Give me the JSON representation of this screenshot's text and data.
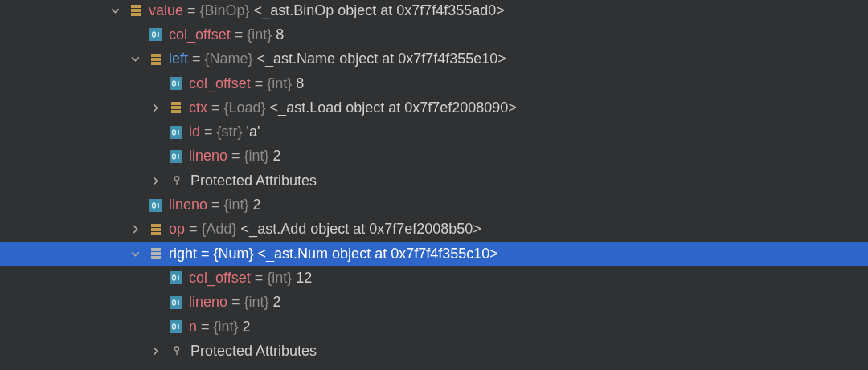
{
  "tree": [
    {
      "kind": "object",
      "name": "value",
      "highlighted": false,
      "selected": false,
      "expanded": true,
      "sep": "=",
      "type": "{BinOp}",
      "value": "<_ast.BinOp object at 0x7f7f4f355ad0>",
      "children": [
        {
          "kind": "field",
          "name": "col_offset",
          "highlighted": false,
          "selected": false,
          "sep": "=",
          "type": "{int}",
          "value": "8"
        },
        {
          "kind": "object",
          "name": "left",
          "highlighted": true,
          "selected": false,
          "expanded": true,
          "sep": "=",
          "type": "{Name}",
          "value": "<_ast.Name object at 0x7f7f4f355e10>",
          "children": [
            {
              "kind": "field",
              "name": "col_offset",
              "highlighted": false,
              "selected": false,
              "sep": "=",
              "type": "{int}",
              "value": "8"
            },
            {
              "kind": "object",
              "name": "ctx",
              "highlighted": false,
              "selected": false,
              "expanded": false,
              "sep": "=",
              "type": "{Load}",
              "value": "<_ast.Load object at 0x7f7ef2008090>"
            },
            {
              "kind": "field",
              "name": "id",
              "highlighted": false,
              "selected": false,
              "sep": "=",
              "type": "{str}",
              "value": "'a'"
            },
            {
              "kind": "field",
              "name": "lineno",
              "highlighted": false,
              "selected": false,
              "sep": "=",
              "type": "{int}",
              "value": "2"
            },
            {
              "kind": "group",
              "name": "Protected Attributes",
              "selected": false,
              "expanded": false
            }
          ]
        },
        {
          "kind": "field",
          "name": "lineno",
          "highlighted": false,
          "selected": false,
          "sep": "=",
          "type": "{int}",
          "value": "2"
        },
        {
          "kind": "object",
          "name": "op",
          "highlighted": false,
          "selected": false,
          "expanded": false,
          "sep": "=",
          "type": "{Add}",
          "value": "<_ast.Add object at 0x7f7ef2008b50>"
        },
        {
          "kind": "object",
          "name": "right",
          "highlighted": false,
          "selected": true,
          "expanded": true,
          "sep": "=",
          "type": "{Num}",
          "value": "<_ast.Num object at 0x7f7f4f355c10>",
          "children": [
            {
              "kind": "field",
              "name": "col_offset",
              "highlighted": false,
              "selected": false,
              "sep": "=",
              "type": "{int}",
              "value": "12"
            },
            {
              "kind": "field",
              "name": "lineno",
              "highlighted": false,
              "selected": false,
              "sep": "=",
              "type": "{int}",
              "value": "2"
            },
            {
              "kind": "field",
              "name": "n",
              "highlighted": false,
              "selected": false,
              "sep": "=",
              "type": "{int}",
              "value": "2"
            },
            {
              "kind": "group",
              "name": "Protected Attributes",
              "selected": false,
              "expanded": false
            }
          ]
        }
      ]
    }
  ]
}
